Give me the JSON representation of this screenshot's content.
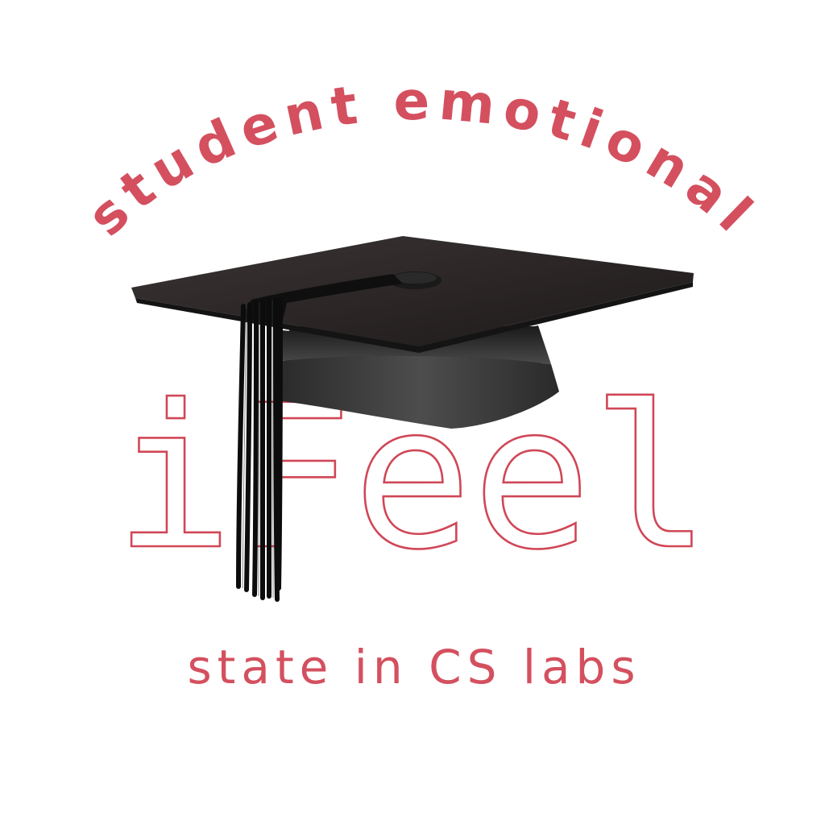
{
  "logo": {
    "arc_text": "student emotional",
    "brand": "iFeel",
    "tagline": "state in CS labs",
    "icon": "graduation-cap-icon",
    "colors": {
      "accent": "#d4505f",
      "outline": "#d04757",
      "cap": "#2a2626",
      "tassel": "#111111",
      "background": "#ffffff"
    }
  }
}
